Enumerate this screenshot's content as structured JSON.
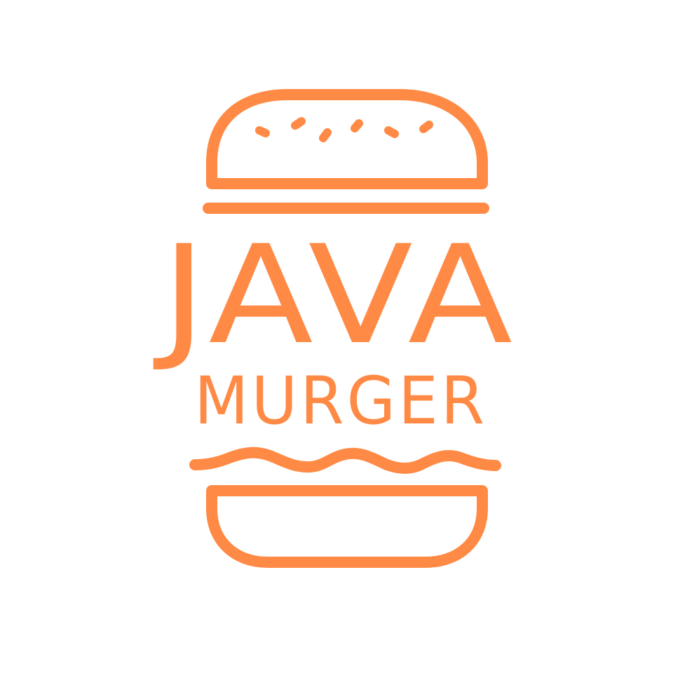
{
  "logo": {
    "name_line1": "JAVA",
    "name_line2": "MURGER",
    "brand_color": "#FF8A45",
    "background": "#FFFFFF",
    "icon": "burger-icon"
  }
}
